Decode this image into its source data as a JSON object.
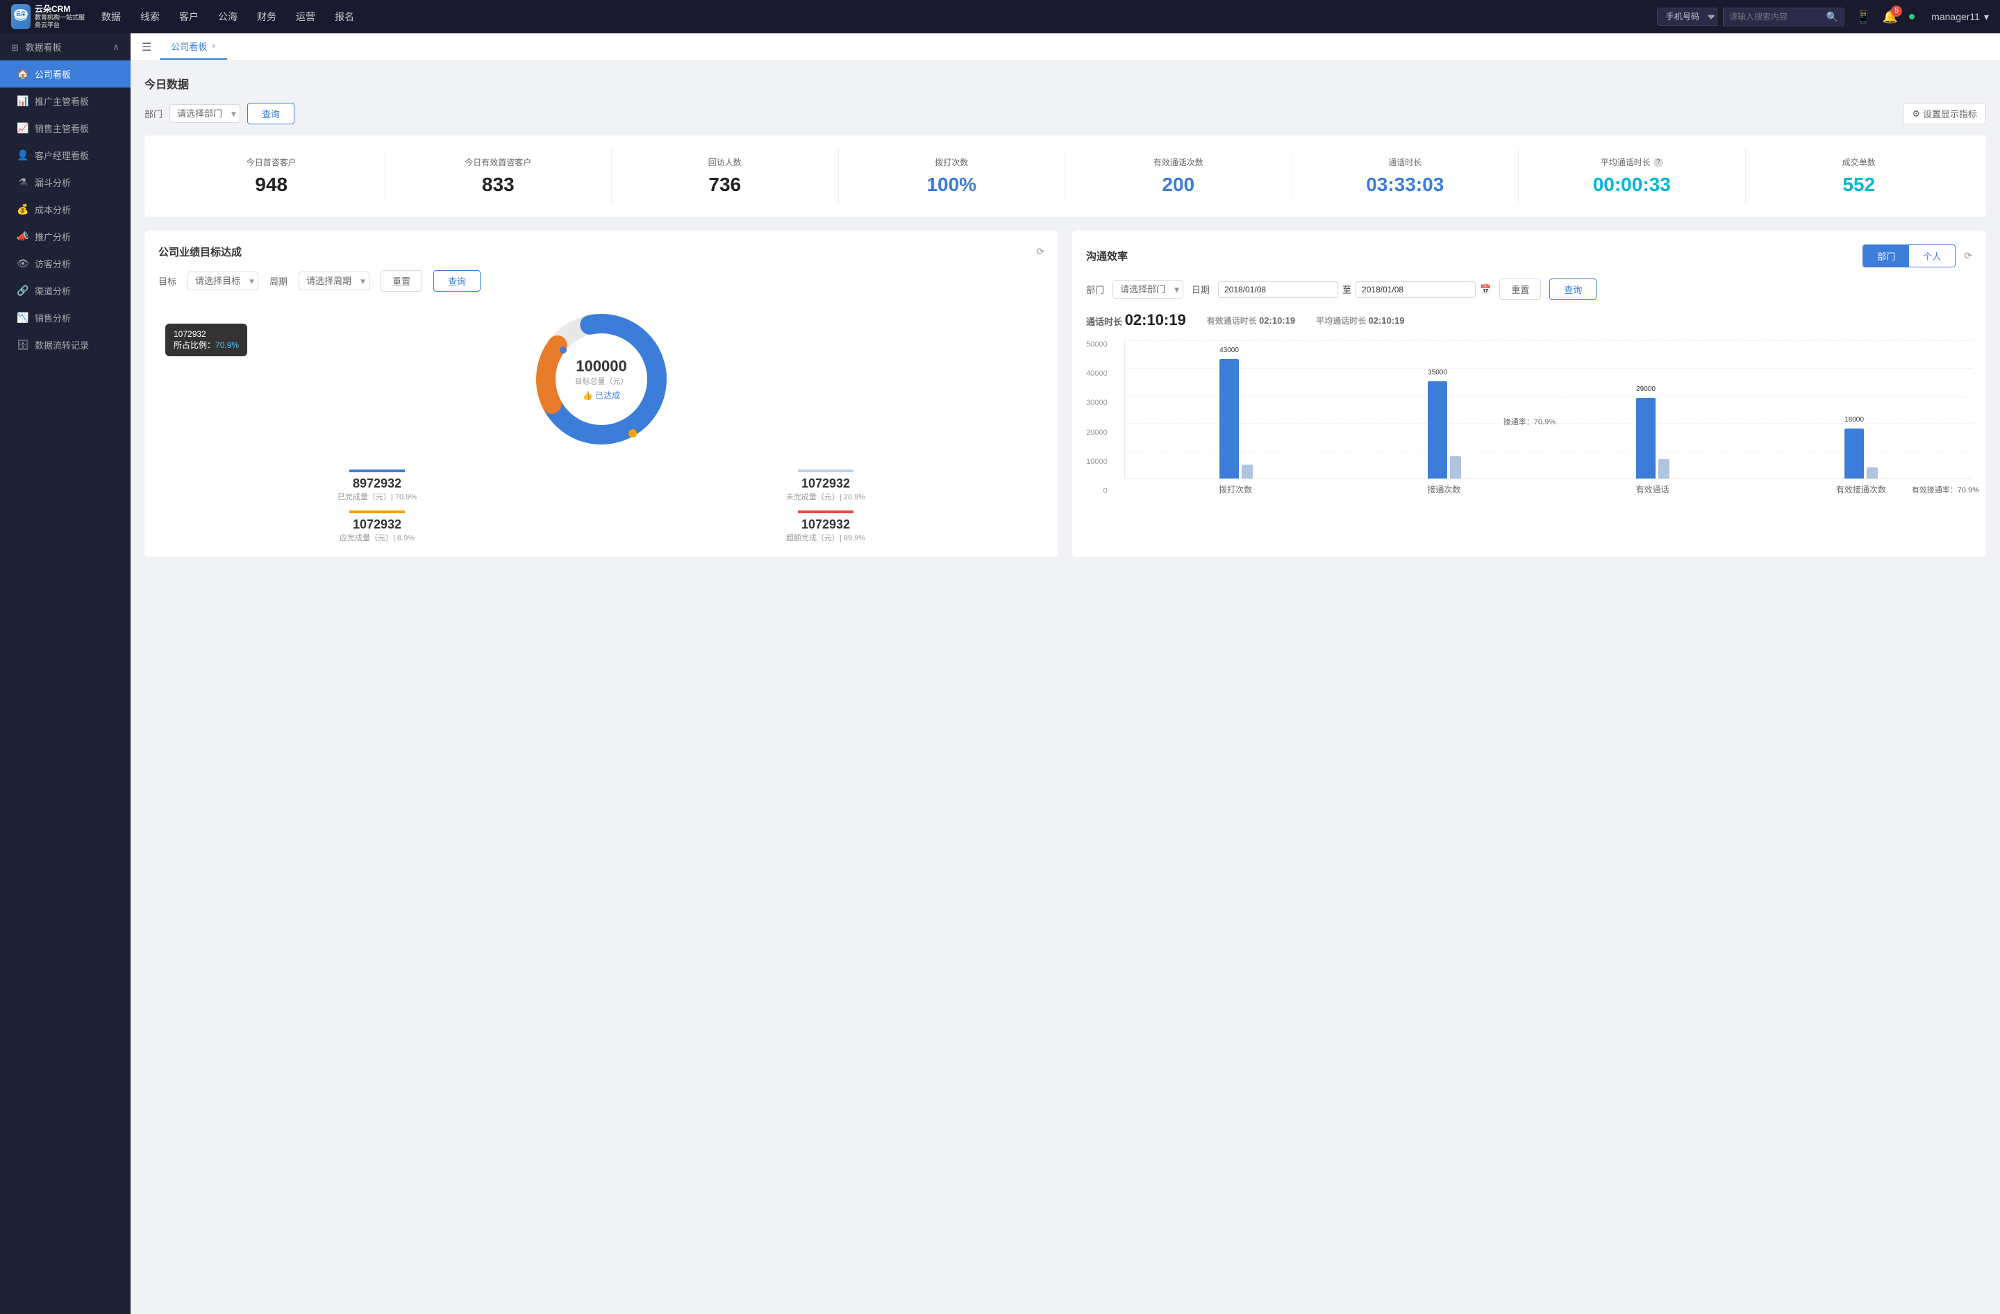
{
  "nav": {
    "logo_text": "云朵CRM",
    "logo_sub": "教育机构一站\n式服务云平台",
    "items": [
      "数据",
      "线索",
      "客户",
      "公海",
      "财务",
      "运营",
      "报名"
    ],
    "search_placeholder": "请输入搜索内容",
    "search_type": "手机号码",
    "badge_count": "5",
    "user": "manager11"
  },
  "sidebar": {
    "section_label": "数据看板",
    "items": [
      {
        "label": "公司看板",
        "icon": "🏠",
        "active": true
      },
      {
        "label": "推广主管看板",
        "icon": "📊",
        "active": false
      },
      {
        "label": "销售主管看板",
        "icon": "📈",
        "active": false
      },
      {
        "label": "客户经理看板",
        "icon": "👤",
        "active": false
      },
      {
        "label": "漏斗分析",
        "icon": "⚗",
        "active": false
      },
      {
        "label": "成本分析",
        "icon": "💰",
        "active": false
      },
      {
        "label": "推广分析",
        "icon": "📣",
        "active": false
      },
      {
        "label": "访客分析",
        "icon": "👁",
        "active": false
      },
      {
        "label": "渠道分析",
        "icon": "🔗",
        "active": false
      },
      {
        "label": "销售分析",
        "icon": "📉",
        "active": false
      },
      {
        "label": "数据流转记录",
        "icon": "🗄",
        "active": false
      }
    ]
  },
  "tab": {
    "label": "公司看板",
    "close": "×"
  },
  "today_section": {
    "title": "今日数据",
    "dept_label": "部门",
    "dept_placeholder": "请选择部门",
    "query_btn": "查询",
    "settings_btn": "设置显示指标",
    "stats": [
      {
        "label": "今日首咨客户",
        "value": "948",
        "color": "dark"
      },
      {
        "label": "今日有效首咨客户",
        "value": "833",
        "color": "dark"
      },
      {
        "label": "回访人数",
        "value": "736",
        "color": "dark"
      },
      {
        "label": "拨打次数",
        "value": "100%",
        "color": "blue"
      },
      {
        "label": "有效通话次数",
        "value": "200",
        "color": "blue"
      },
      {
        "label": "通话时长",
        "value": "03:33:03",
        "color": "blue"
      },
      {
        "label": "平均通话时长",
        "value": "00:00:33",
        "color": "cyan",
        "has_info": true
      },
      {
        "label": "成交单数",
        "value": "552",
        "color": "cyan"
      }
    ]
  },
  "performance_panel": {
    "title": "公司业绩目标达成",
    "target_label": "目标",
    "target_placeholder": "请选择目标",
    "period_label": "周期",
    "period_placeholder": "请选择周期",
    "reset_btn": "重置",
    "query_btn": "查询",
    "donut": {
      "target_value": "100000",
      "target_unit": "目标总量（元）",
      "achieved_label": "👍 已达成",
      "tooltip_value": "1072932",
      "tooltip_percent": "70.9%",
      "tooltip_prefix": "所占比例："
    },
    "stats": [
      {
        "label": "已完成量（元）| 70.9%",
        "value": "8972932",
        "bar_color": "#3b7dd8"
      },
      {
        "label": "未完成量（元）| 20.9%",
        "value": "1072932",
        "bar_color": "#c0cfe8"
      },
      {
        "label": "应完成量（元）| 8.9%",
        "value": "1072932",
        "bar_color": "#f0a500"
      },
      {
        "label": "超额完成（元）| 89.9%",
        "value": "1072932",
        "bar_color": "#e74c3c"
      }
    ]
  },
  "efficiency_panel": {
    "title": "沟通效率",
    "tab_dept": "部门",
    "tab_personal": "个人",
    "dept_label": "部门",
    "dept_placeholder": "请选择部门",
    "date_label": "日期",
    "date_from": "2018/01/08",
    "date_to": "2018/01/08",
    "reset_btn": "重置",
    "query_btn": "查询",
    "call_stats": {
      "duration_label": "通话时长",
      "duration_value": "02:10:19",
      "effective_label": "有效通话时长",
      "effective_value": "02:10:19",
      "avg_label": "平均通话时长",
      "avg_value": "02:10:19"
    },
    "chart": {
      "y_labels": [
        "50000",
        "40000",
        "30000",
        "20000",
        "10000",
        "0"
      ],
      "groups": [
        {
          "x_label": "拨打次数",
          "bars": [
            {
              "value": 43000,
              "color": "#3b7dd8",
              "label": "43000",
              "height_pct": 86
            },
            {
              "value": 5000,
              "color": "#b0c4de",
              "label": "",
              "height_pct": 10
            }
          ]
        },
        {
          "x_label": "接通次数",
          "annotation": "接通率：70.9%",
          "bars": [
            {
              "value": 35000,
              "color": "#3b7dd8",
              "label": "35000",
              "height_pct": 70
            },
            {
              "value": 8000,
              "color": "#b0c4de",
              "label": "",
              "height_pct": 16
            }
          ]
        },
        {
          "x_label": "有效通话",
          "bars": [
            {
              "value": 29000,
              "color": "#3b7dd8",
              "label": "29000",
              "height_pct": 58
            },
            {
              "value": 7000,
              "color": "#b0c4de",
              "label": "",
              "height_pct": 14
            }
          ]
        },
        {
          "x_label": "有效接通次数",
          "annotation": "有效接通率：70.9%",
          "bars": [
            {
              "value": 18000,
              "color": "#3b7dd8",
              "label": "18000",
              "height_pct": 36
            },
            {
              "value": 4000,
              "color": "#b0c4de",
              "label": "",
              "height_pct": 8
            }
          ]
        }
      ]
    }
  }
}
